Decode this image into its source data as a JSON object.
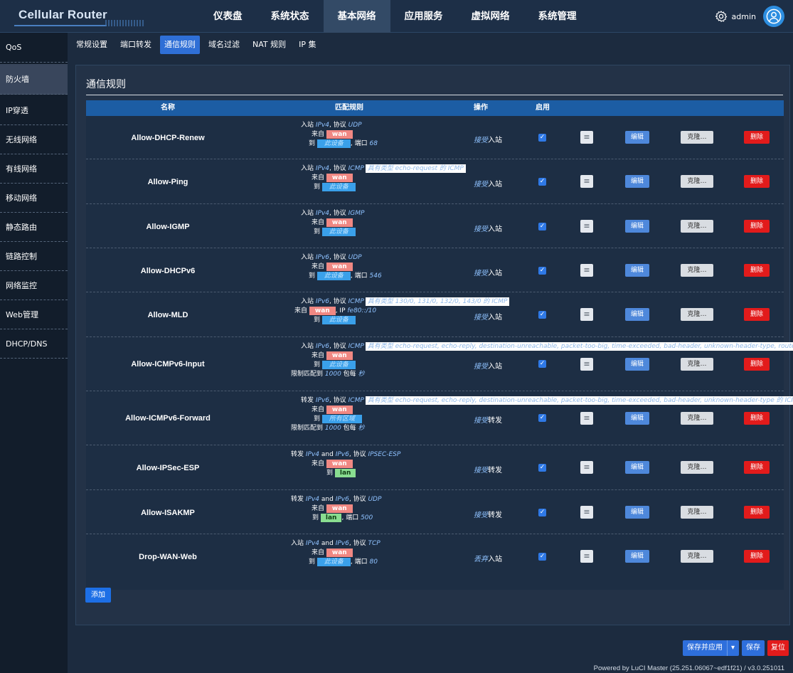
{
  "app": {
    "title": "Cellular Router"
  },
  "nav": [
    "仪表盘",
    "系统状态",
    "基本网络",
    "应用服务",
    "虚拟网络",
    "系统管理"
  ],
  "user": {
    "name": "admin",
    "settings_icon": "gear-icon",
    "avatar_icon": "user-avatar-icon"
  },
  "sidebar": [
    "QoS",
    "防火墙",
    "IP穿透",
    "无线网络",
    "有线网络",
    "移动网络",
    "静态路由",
    "链路控制",
    "网络监控",
    "Web管理",
    "DHCP/DNS"
  ],
  "subtabs": [
    "常规设置",
    "端口转发",
    "通信规则",
    "域名过滤",
    "NAT 规则",
    "IP 集"
  ],
  "panel": {
    "title": "通信规则"
  },
  "table": {
    "headers": {
      "name": "名称",
      "match": "匹配规则",
      "action": "操作",
      "enable": "启用"
    },
    "rows": [
      {
        "name": "Allow-DHCP-Renew",
        "l1": {
          "dir": "入站",
          "family": "IPv4",
          "sep": ", 协议",
          "proto": "UDP"
        },
        "from": "wan",
        "to_dev": "此设备",
        "port": {
          "label": ", 端口",
          "value": "68"
        },
        "action": {
          "verb": "接受",
          "target": "入站"
        },
        "enabled": "✓",
        "buttons": {
          "edit": "编辑",
          "clone": "克隆…",
          "delete": "删除"
        }
      },
      {
        "name": "Allow-Ping",
        "l1": {
          "dir": "入站",
          "family": "IPv4",
          "sep": ", 协议",
          "proto": "ICMP"
        },
        "tip": "具有类型 echo-request 的 ICMP",
        "from": "wan",
        "to_dev": "此设备",
        "action": {
          "verb": "接受",
          "target": "入站"
        },
        "enabled": "✓",
        "buttons": {
          "edit": "编辑",
          "clone": "克隆…",
          "delete": "删除"
        }
      },
      {
        "name": "Allow-IGMP",
        "l1": {
          "dir": "入站",
          "family": "IPv4",
          "sep": ", 协议",
          "proto": "IGMP"
        },
        "from": "wan",
        "to_dev": "此设备",
        "action": {
          "verb": "接受",
          "target": "入站"
        },
        "enabled": "✓",
        "buttons": {
          "edit": "编辑",
          "clone": "克隆…",
          "delete": "删除"
        }
      },
      {
        "name": "Allow-DHCPv6",
        "l1": {
          "dir": "入站",
          "family": "IPv6",
          "sep": ", 协议",
          "proto": "UDP"
        },
        "from": "wan",
        "to_dev": "此设备",
        "port": {
          "label": ", 端口",
          "value": "546"
        },
        "action": {
          "verb": "接受",
          "target": "入站"
        },
        "enabled": "✓",
        "buttons": {
          "edit": "编辑",
          "clone": "克隆…",
          "delete": "删除"
        }
      },
      {
        "name": "Allow-MLD",
        "l1": {
          "dir": "入站",
          "family": "IPv6",
          "sep": ", 协议",
          "proto": "ICMP"
        },
        "tip": "具有类型 130/0, 131/0, 132/0, 143/0 的 ICMP",
        "from": "wan",
        "ip": {
          "label": ", IP",
          "value": "fe80::/10"
        },
        "to_dev": "此设备",
        "action": {
          "verb": "接受",
          "target": "入站"
        },
        "enabled": "✓",
        "buttons": {
          "edit": "编辑",
          "clone": "克隆…",
          "delete": "删除"
        }
      },
      {
        "name": "Allow-ICMPv6-Input",
        "l1": {
          "dir": "入站",
          "family": "IPv6",
          "sep": ", 协议",
          "proto": "ICMP"
        },
        "tip": "具有类型 echo-request, echo-reply, destination-unreachable, packet-too-big, time-exceeded, bad-header, unknown-header-type, route",
        "from": "wan",
        "to_dev": "此设备",
        "limit": {
          "label": "限制匹配到",
          "value": "1000",
          "unit": "包每",
          "per": "秒"
        },
        "action": {
          "verb": "接受",
          "target": "入站"
        },
        "enabled": "✓",
        "buttons": {
          "edit": "编辑",
          "clone": "克隆…",
          "delete": "删除"
        }
      },
      {
        "name": "Allow-ICMPv6-Forward",
        "l1": {
          "dir": "转发",
          "family": "IPv6",
          "sep": ", 协议",
          "proto": "ICMP"
        },
        "tip": "具有类型 echo-request, echo-reply, destination-unreachable, packet-too-big, time-exceeded, bad-header, unknown-header-type 的 ICI",
        "from": "wan",
        "to_dev": "所有区域",
        "limit": {
          "label": "限制匹配到",
          "value": "1000",
          "unit": "包每",
          "per": "秒"
        },
        "action": {
          "verb": "接受",
          "target": "转发"
        },
        "enabled": "✓",
        "buttons": {
          "edit": "编辑",
          "clone": "克隆…",
          "delete": "删除"
        }
      },
      {
        "name": "Allow-IPSec-ESP",
        "l1": {
          "dir": "转发",
          "family": "IPv4",
          "and": "and",
          "family2": "IPv6",
          "sep": ", 协议",
          "proto": "IPSEC-ESP"
        },
        "from": "wan",
        "to_lan": "lan",
        "action": {
          "verb": "接受",
          "target": "转发"
        },
        "enabled": "✓",
        "buttons": {
          "edit": "编辑",
          "clone": "克隆…",
          "delete": "删除"
        }
      },
      {
        "name": "Allow-ISAKMP",
        "l1": {
          "dir": "转发",
          "family": "IPv4",
          "and": "and",
          "family2": "IPv6",
          "sep": ", 协议",
          "proto": "UDP"
        },
        "from": "wan",
        "to_lan": "lan",
        "port": {
          "label": ", 端口",
          "value": "500"
        },
        "action": {
          "verb": "接受",
          "target": "转发"
        },
        "enabled": "✓",
        "buttons": {
          "edit": "编辑",
          "clone": "克隆…",
          "delete": "删除"
        }
      },
      {
        "name": "Drop-WAN-Web",
        "l1": {
          "dir": "入站",
          "family": "IPv4",
          "and": "and",
          "family2": "IPv6",
          "sep": ", 协议",
          "proto": "TCP"
        },
        "from": "wan",
        "to_dev": "此设备",
        "port": {
          "label": ", 端口",
          "value": "80"
        },
        "action": {
          "verb": "丢弃",
          "target": "入站"
        },
        "enabled": "✓",
        "buttons": {
          "edit": "编辑",
          "clone": "克隆…",
          "delete": "删除"
        }
      }
    ]
  },
  "labels": {
    "from": "来自",
    "to": "到"
  },
  "add_button": "添加",
  "footer": {
    "save_apply": "保存并应用",
    "caret": "▾",
    "save": "保存",
    "reset": "复位",
    "powered": "Powered by LuCI Master (25.251.06067~edf1f21) / v3.0.251011"
  },
  "colors": {
    "accent": "#2e6fdc",
    "delete": "#e21b1b",
    "wan": "#f08883",
    "lan": "#89dd90",
    "device": "#3aa0ea"
  }
}
